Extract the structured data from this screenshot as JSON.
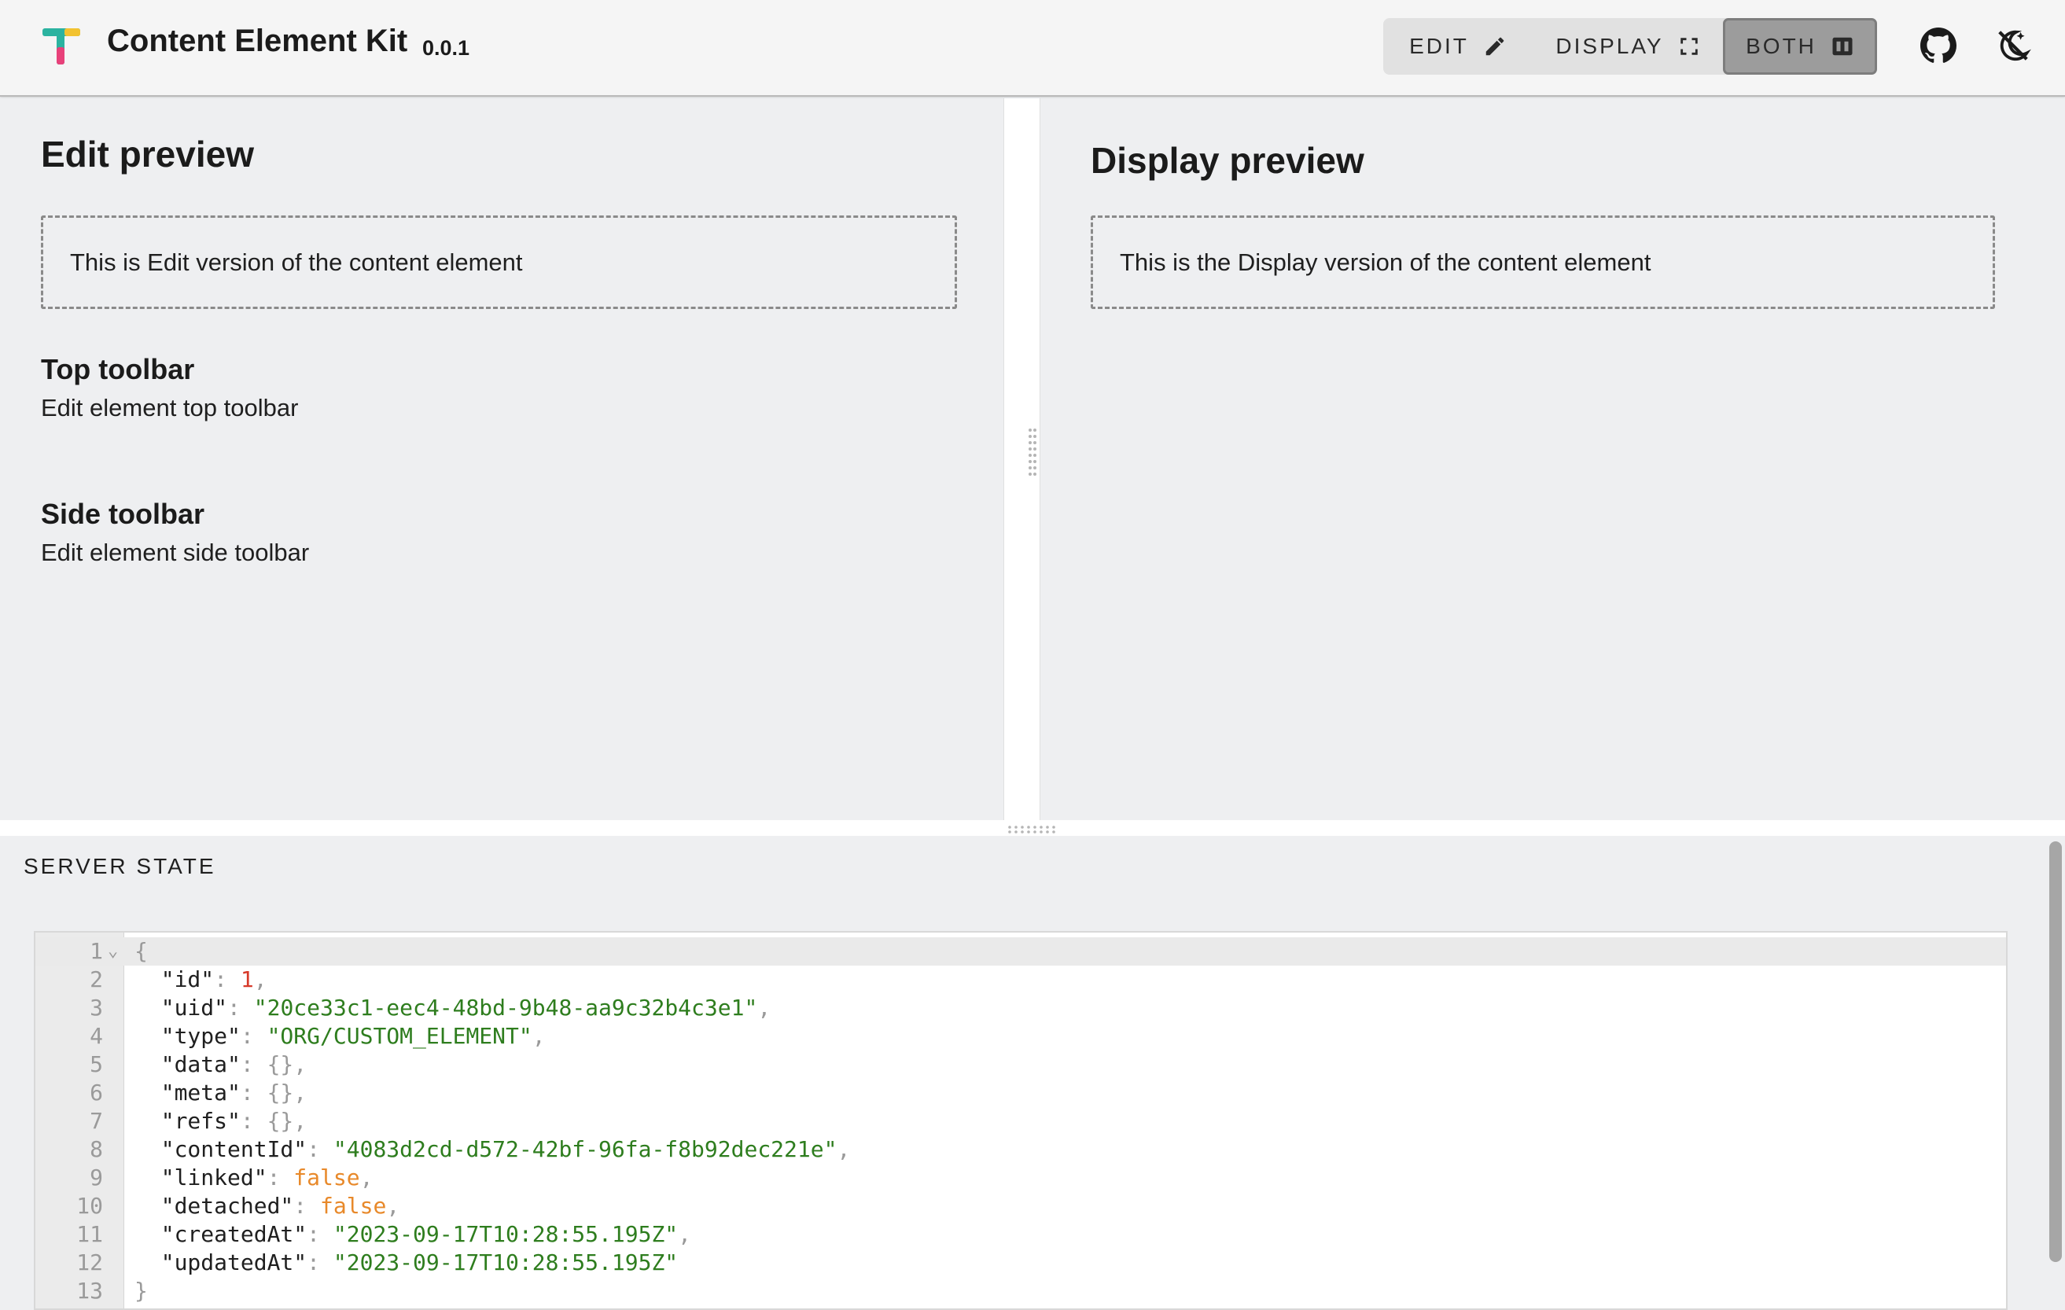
{
  "header": {
    "title": "Content Element Kit",
    "version": "0.0.1",
    "modes": [
      {
        "label": "EDIT",
        "icon": "pencil-icon"
      },
      {
        "label": "DISPLAY",
        "icon": "fullscreen-icon"
      },
      {
        "label": "BOTH",
        "icon": "split-view-icon",
        "active": true
      }
    ],
    "right_icons": [
      "github-icon",
      "theme-toggle-icon"
    ],
    "logo_colors": [
      "#2bb3a0",
      "#f2c230",
      "#e8417a"
    ]
  },
  "edit_panel": {
    "title": "Edit preview",
    "preview_text": "This is Edit version of the content element",
    "sections": [
      {
        "title": "Top toolbar",
        "text": "Edit element top toolbar"
      },
      {
        "title": "Side toolbar",
        "text": "Edit element side toolbar"
      }
    ]
  },
  "display_panel": {
    "title": "Display preview",
    "preview_text": "This is the Display version of the content element"
  },
  "server_state": {
    "title": "SERVER STATE",
    "lines": [
      {
        "n": "1",
        "tokens": [
          {
            "t": "{",
            "c": "t-brace"
          }
        ]
      },
      {
        "n": "2",
        "tokens": [
          {
            "t": "  \"id\"",
            "c": "t-key"
          },
          {
            "t": ": ",
            "c": "t-punct"
          },
          {
            "t": "1",
            "c": "t-num"
          },
          {
            "t": ",",
            "c": "t-punct"
          }
        ]
      },
      {
        "n": "3",
        "tokens": [
          {
            "t": "  \"uid\"",
            "c": "t-key"
          },
          {
            "t": ": ",
            "c": "t-punct"
          },
          {
            "t": "\"20ce33c1-eec4-48bd-9b48-aa9c32b4c3e1\"",
            "c": "t-str"
          },
          {
            "t": ",",
            "c": "t-punct"
          }
        ]
      },
      {
        "n": "4",
        "tokens": [
          {
            "t": "  \"type\"",
            "c": "t-key"
          },
          {
            "t": ": ",
            "c": "t-punct"
          },
          {
            "t": "\"ORG/CUSTOM_ELEMENT\"",
            "c": "t-str"
          },
          {
            "t": ",",
            "c": "t-punct"
          }
        ]
      },
      {
        "n": "5",
        "tokens": [
          {
            "t": "  \"data\"",
            "c": "t-key"
          },
          {
            "t": ": {},",
            "c": "t-punct"
          }
        ]
      },
      {
        "n": "6",
        "tokens": [
          {
            "t": "  \"meta\"",
            "c": "t-key"
          },
          {
            "t": ": {},",
            "c": "t-punct"
          }
        ]
      },
      {
        "n": "7",
        "tokens": [
          {
            "t": "  \"refs\"",
            "c": "t-key"
          },
          {
            "t": ": {},",
            "c": "t-punct"
          }
        ]
      },
      {
        "n": "8",
        "tokens": [
          {
            "t": "  \"contentId\"",
            "c": "t-key"
          },
          {
            "t": ": ",
            "c": "t-punct"
          },
          {
            "t": "\"4083d2cd-d572-42bf-96fa-f8b92dec221e\"",
            "c": "t-str"
          },
          {
            "t": ",",
            "c": "t-punct"
          }
        ]
      },
      {
        "n": "9",
        "tokens": [
          {
            "t": "  \"linked\"",
            "c": "t-key"
          },
          {
            "t": ": ",
            "c": "t-punct"
          },
          {
            "t": "false",
            "c": "t-bool"
          },
          {
            "t": ",",
            "c": "t-punct"
          }
        ]
      },
      {
        "n": "10",
        "tokens": [
          {
            "t": "  \"detached\"",
            "c": "t-key"
          },
          {
            "t": ": ",
            "c": "t-punct"
          },
          {
            "t": "false",
            "c": "t-bool"
          },
          {
            "t": ",",
            "c": "t-punct"
          }
        ]
      },
      {
        "n": "11",
        "tokens": [
          {
            "t": "  \"createdAt\"",
            "c": "t-key"
          },
          {
            "t": ": ",
            "c": "t-punct"
          },
          {
            "t": "\"2023-09-17T10:28:55.195Z\"",
            "c": "t-str"
          },
          {
            "t": ",",
            "c": "t-punct"
          }
        ]
      },
      {
        "n": "12",
        "tokens": [
          {
            "t": "  \"updatedAt\"",
            "c": "t-key"
          },
          {
            "t": ": ",
            "c": "t-punct"
          },
          {
            "t": "\"2023-09-17T10:28:55.195Z\"",
            "c": "t-str"
          }
        ]
      },
      {
        "n": "13",
        "tokens": [
          {
            "t": "}",
            "c": "t-brace"
          }
        ]
      }
    ]
  }
}
